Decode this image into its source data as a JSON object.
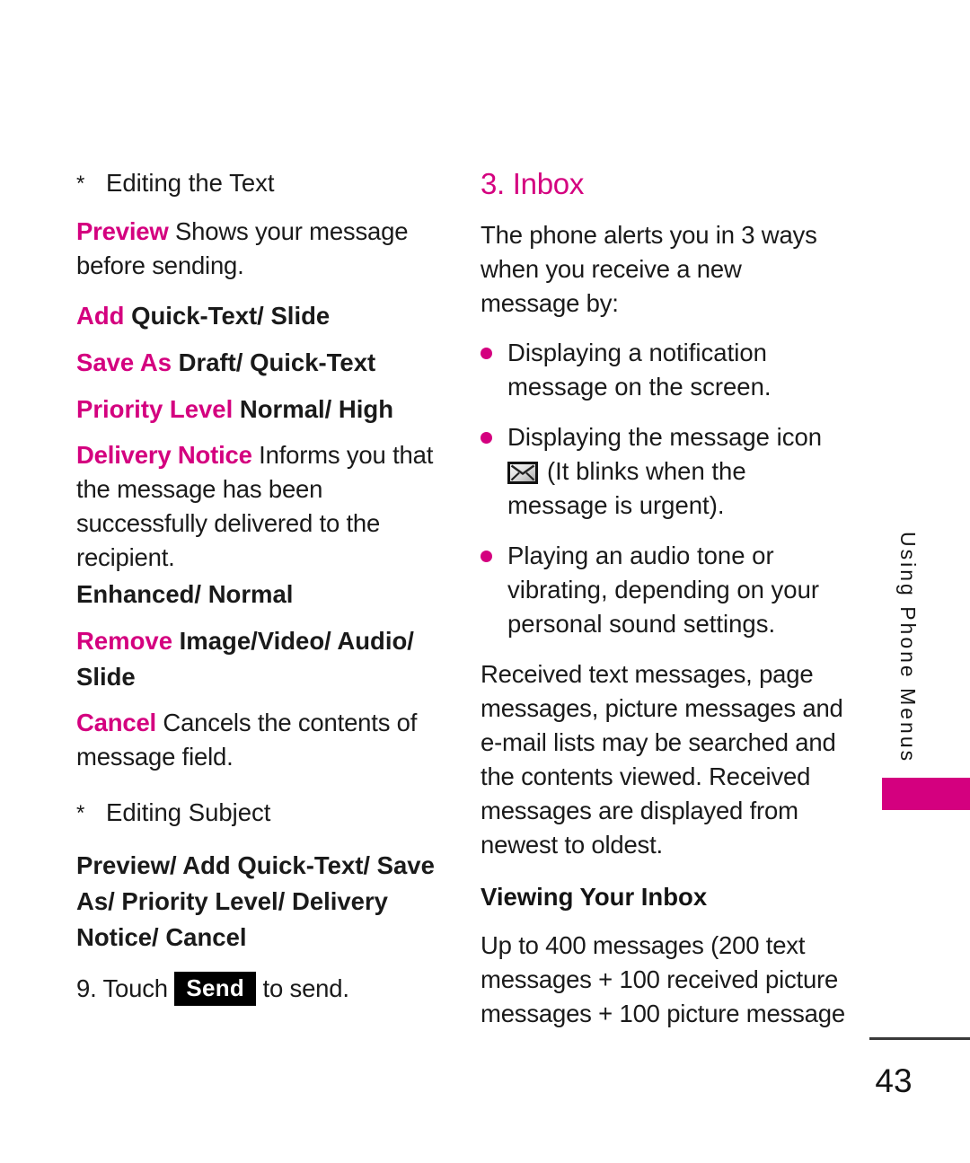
{
  "meta": {
    "page_number": "43",
    "running_head": "Using Phone Menus",
    "accent_color": "#d4007f"
  },
  "left_column": {
    "editing_text_heading": {
      "marker": "*",
      "label": "Editing the Text"
    },
    "preview_entry": {
      "keyword": "Preview",
      "body": " Shows your message before sending."
    },
    "options": [
      {
        "keyword": "Add",
        "values": " Quick-Text/ Slide"
      },
      {
        "keyword": "Save As",
        "values": " Draft/ Quick-Text"
      },
      {
        "keyword": "Priority Level",
        "values": " Normal/ High"
      }
    ],
    "delivery_notice": {
      "keyword": "Delivery Notice",
      "body": " Informs you that the message has been successfully delivered to the recipient.",
      "values": "Enhanced/ Normal"
    },
    "remove_entry": {
      "keyword": "Remove",
      "values": " Image/Video/ Audio/ Slide"
    },
    "cancel_entry": {
      "keyword": "Cancel",
      "body": " Cancels the contents of message field."
    },
    "editing_subject_heading": {
      "marker": "*",
      "label": "Editing Subject"
    },
    "subject_options": "Preview/ Add Quick-Text/ Save As/ Priority Level/ Delivery Notice/ Cancel",
    "step_nine": {
      "prefix": "9. Touch",
      "key_label": "Send",
      "suffix": "to send."
    }
  },
  "right_column": {
    "section_heading": "3. Inbox",
    "intro": "The phone alerts you in 3 ways when you receive a new message by:",
    "alerts": [
      {
        "text": "Displaying a notification message on the screen.",
        "has_icon": false
      },
      {
        "text_before_icon": "Displaying the message icon",
        "icon": "envelope-icon",
        "text_after_icon": "(It blinks when the message is urgent).",
        "has_icon": true
      },
      {
        "text": "Playing an audio tone or vibrating, depending on your personal sound settings.",
        "has_icon": false
      }
    ],
    "received_paragraph": "Received text messages, page messages, picture messages and e-mail lists may be searched and the contents viewed. Received messages are displayed from newest to oldest.",
    "viewing_heading": "Viewing Your Inbox",
    "capacity_paragraph": "Up to 400 messages (200 text messages + 100 received picture messages + 100 picture message"
  }
}
